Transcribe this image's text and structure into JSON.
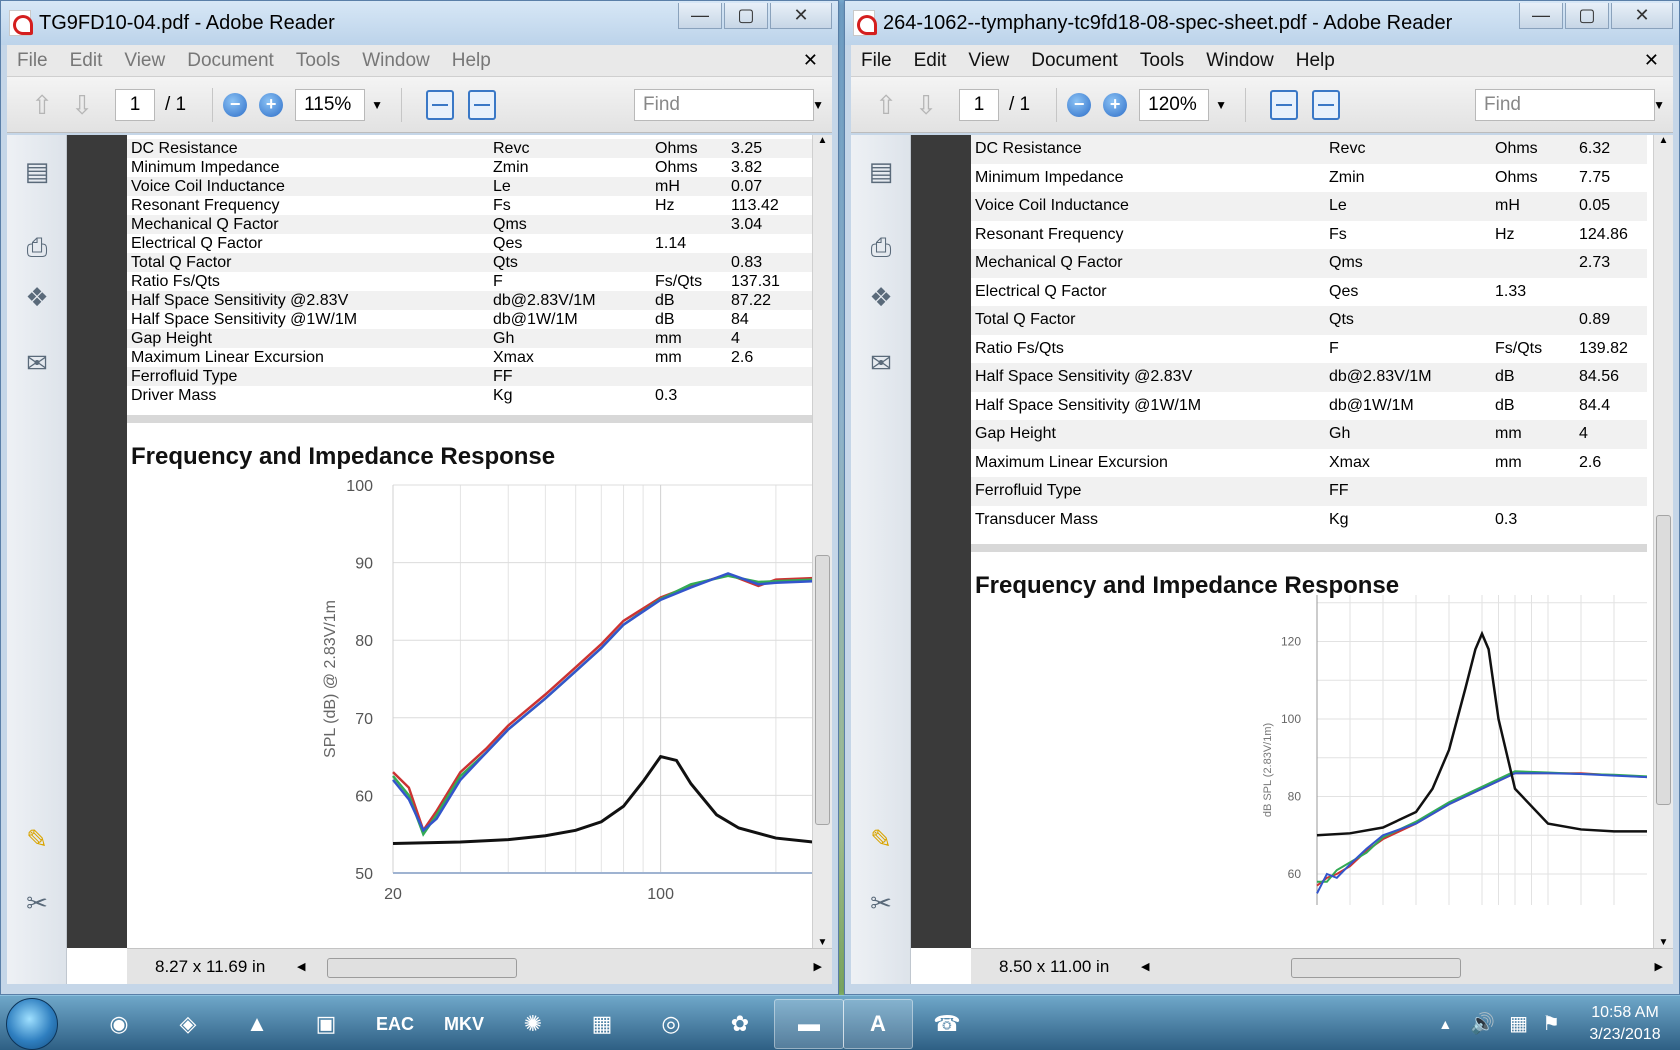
{
  "colors": {
    "spl_red": "#cc3333",
    "spl_green": "#33aa55",
    "spl_blue": "#3355cc",
    "impedance": "#111111"
  },
  "windows": [
    {
      "title": "TG9FD10-04.pdf - Adobe Reader",
      "menu": [
        "File",
        "Edit",
        "View",
        "Document",
        "Tools",
        "Window",
        "Help"
      ],
      "page_current": "1",
      "page_total": "/ 1",
      "zoom": "115%",
      "find_placeholder": "Find",
      "page_size": "8.27 x 11.69 in",
      "specs": [
        [
          "DC Resistance",
          "Revc",
          "Ohms",
          "3.25"
        ],
        [
          "Minimum Impedance",
          "Zmin",
          "Ohms",
          "3.82"
        ],
        [
          "Voice Coil Inductance",
          "Le",
          "mH",
          "0.07"
        ],
        [
          "Resonant Frequency",
          "Fs",
          "Hz",
          "113.42"
        ],
        [
          "Mechanical Q Factor",
          "Qms",
          "",
          "3.04"
        ],
        [
          "Electrical Q Factor",
          "Qes",
          "1.14",
          ""
        ],
        [
          "Total Q Factor",
          "Qts",
          "",
          "0.83"
        ],
        [
          "Ratio Fs/Qts",
          "F",
          "Fs/Qts",
          "137.31"
        ],
        [
          "Half Space Sensitivity @2.83V",
          "db@2.83V/1M",
          "dB",
          "87.22"
        ],
        [
          "Half Space Sensitivity @1W/1M",
          "db@1W/1M",
          "dB",
          "84"
        ],
        [
          "Gap Height",
          "Gh",
          "mm",
          "4"
        ],
        [
          "Maximum Linear Excursion",
          "Xmax",
          "mm",
          "2.6"
        ],
        [
          "Ferrofluid Type",
          "FF",
          "",
          ""
        ],
        [
          "Driver Mass",
          "Kg",
          "0.3",
          ""
        ]
      ],
      "section_title": "Frequency and Impedance Response",
      "chart_data": {
        "type": "line",
        "ylabel": "SPL (dB) @ 2.83V/1m",
        "ylim": [
          50,
          100
        ],
        "yticks": [
          100,
          90,
          80,
          70,
          60,
          50
        ],
        "xlim": [
          20,
          250
        ],
        "xticks": [
          20,
          100
        ],
        "xscale": "log",
        "series": [
          {
            "color": "#cc3333",
            "x": [
              20,
              22,
              24,
              26,
              30,
              35,
              40,
              50,
              60,
              70,
              80,
              100,
              120,
              150,
              180,
              200,
              250
            ],
            "y": [
              63,
              61,
              55.5,
              58,
              63,
              66,
              69,
              73,
              76.5,
              79.5,
              82.5,
              85.5,
              87,
              88.5,
              87,
              87.8,
              88
            ]
          },
          {
            "color": "#33aa55",
            "x": [
              20,
              22,
              24,
              26,
              30,
              35,
              40,
              50,
              60,
              70,
              80,
              100,
              120,
              150,
              180,
              200,
              250
            ],
            "y": [
              62.5,
              60,
              55,
              57.5,
              62.5,
              65.5,
              68.5,
              72.5,
              76,
              79,
              82,
              85.3,
              87.2,
              88.3,
              87.5,
              87.6,
              87.8
            ]
          },
          {
            "color": "#3355cc",
            "x": [
              20,
              22,
              24,
              26,
              30,
              35,
              40,
              50,
              60,
              70,
              80,
              100,
              120,
              150,
              180,
              200,
              250
            ],
            "y": [
              62,
              59.5,
              55.5,
              57,
              62,
              65.5,
              68.5,
              72.5,
              76,
              79,
              82,
              85.2,
              86.8,
              88.6,
              87.2,
              87.4,
              87.6
            ]
          },
          {
            "color": "#111111",
            "x": [
              20,
              30,
              40,
              50,
              60,
              70,
              80,
              90,
              100,
              110,
              120,
              140,
              160,
              200,
              250
            ],
            "y": [
              53.8,
              54,
              54.3,
              54.8,
              55.5,
              56.6,
              58.6,
              61.8,
              65,
              64.5,
              61.5,
              57.5,
              55.8,
              54.5,
              54
            ]
          }
        ]
      }
    },
    {
      "title": "264-1062--tymphany-tc9fd18-08-spec-sheet.pdf - Adobe Reader",
      "menu": [
        "File",
        "Edit",
        "View",
        "Document",
        "Tools",
        "Window",
        "Help"
      ],
      "page_current": "1",
      "page_total": "/ 1",
      "zoom": "120%",
      "find_placeholder": "Find",
      "page_size": "8.50 x 11.00 in",
      "specs": [
        [
          "DC Resistance",
          "Revc",
          "Ohms",
          "6.32"
        ],
        [
          "Minimum Impedance",
          "Zmin",
          "Ohms",
          "7.75"
        ],
        [
          "Voice Coil Inductance",
          "Le",
          "mH",
          "0.05"
        ],
        [
          "Resonant Frequency",
          "Fs",
          "Hz",
          "124.86"
        ],
        [
          "Mechanical Q Factor",
          "Qms",
          "",
          "2.73"
        ],
        [
          "Electrical Q Factor",
          "Qes",
          "1.33",
          ""
        ],
        [
          "Total Q Factor",
          "Qts",
          "",
          "0.89"
        ],
        [
          "Ratio Fs/Qts",
          "F",
          "Fs/Qts",
          "139.82"
        ],
        [
          "Half Space Sensitivity @2.83V",
          "db@2.83V/1M",
          "dB",
          "84.56"
        ],
        [
          "Half Space Sensitivity @1W/1M",
          "db@1W/1M",
          "dB",
          "84.4"
        ],
        [
          "Gap Height",
          "Gh",
          "mm",
          "4"
        ],
        [
          "Maximum Linear Excursion",
          "Xmax",
          "mm",
          "2.6"
        ],
        [
          "Ferrofluid Type",
          "FF",
          "",
          ""
        ],
        [
          "Transducer Mass",
          "Kg",
          "0.3",
          ""
        ]
      ],
      "section_title": "Frequency and Impedance Response",
      "chart_data": {
        "type": "line",
        "ylabel": "dB SPL (2.83V/1m)",
        "ylim": [
          52,
          132
        ],
        "yticks": [
          120,
          100,
          80,
          60
        ],
        "series": [
          {
            "color": "#cc3333",
            "x": [
              0,
              3,
              6,
              10,
              15,
              20,
              30,
              40,
              50,
              60,
              70,
              80,
              90,
              100
            ],
            "y": [
              57,
              59,
              60,
              62,
              66,
              69,
              73,
              78,
              82,
              86,
              86,
              86,
              85.5,
              85
            ]
          },
          {
            "color": "#33aa55",
            "x": [
              0,
              3,
              6,
              10,
              15,
              20,
              30,
              40,
              50,
              60,
              70,
              80,
              90,
              100
            ],
            "y": [
              58,
              58,
              61,
              63,
              65.5,
              69.5,
              73.5,
              78.5,
              82.5,
              86.5,
              86.2,
              85.8,
              85.6,
              85.2
            ]
          },
          {
            "color": "#3355cc",
            "x": [
              0,
              3,
              6,
              10,
              15,
              20,
              30,
              40,
              50,
              60,
              70,
              80,
              90,
              100
            ],
            "y": [
              55,
              60,
              59,
              62.5,
              66.5,
              70,
              73,
              78,
              82,
              86,
              86,
              85.8,
              85.4,
              85
            ]
          },
          {
            "color": "#111111",
            "x": [
              0,
              10,
              20,
              30,
              35,
              40,
              45,
              48,
              50,
              52,
              55,
              60,
              70,
              80,
              90,
              100
            ],
            "y": [
              70,
              70.5,
              72,
              76,
              82,
              92,
              108,
              118,
              122,
              118,
              100,
              82,
              73,
              71.5,
              71,
              71
            ]
          }
        ]
      }
    }
  ],
  "taskbar": {
    "time": "10:58 AM",
    "date": "3/23/2018",
    "items": [
      "firefox-icon",
      "media-player-icon",
      "vlc-icon",
      "mpc-321-icon",
      "EAC",
      "MKV",
      "fire-icon",
      "calculator-icon",
      "dvd-icon",
      "paint-icon",
      "folder-icon",
      "acrobat-icon",
      "phone-icon"
    ]
  }
}
